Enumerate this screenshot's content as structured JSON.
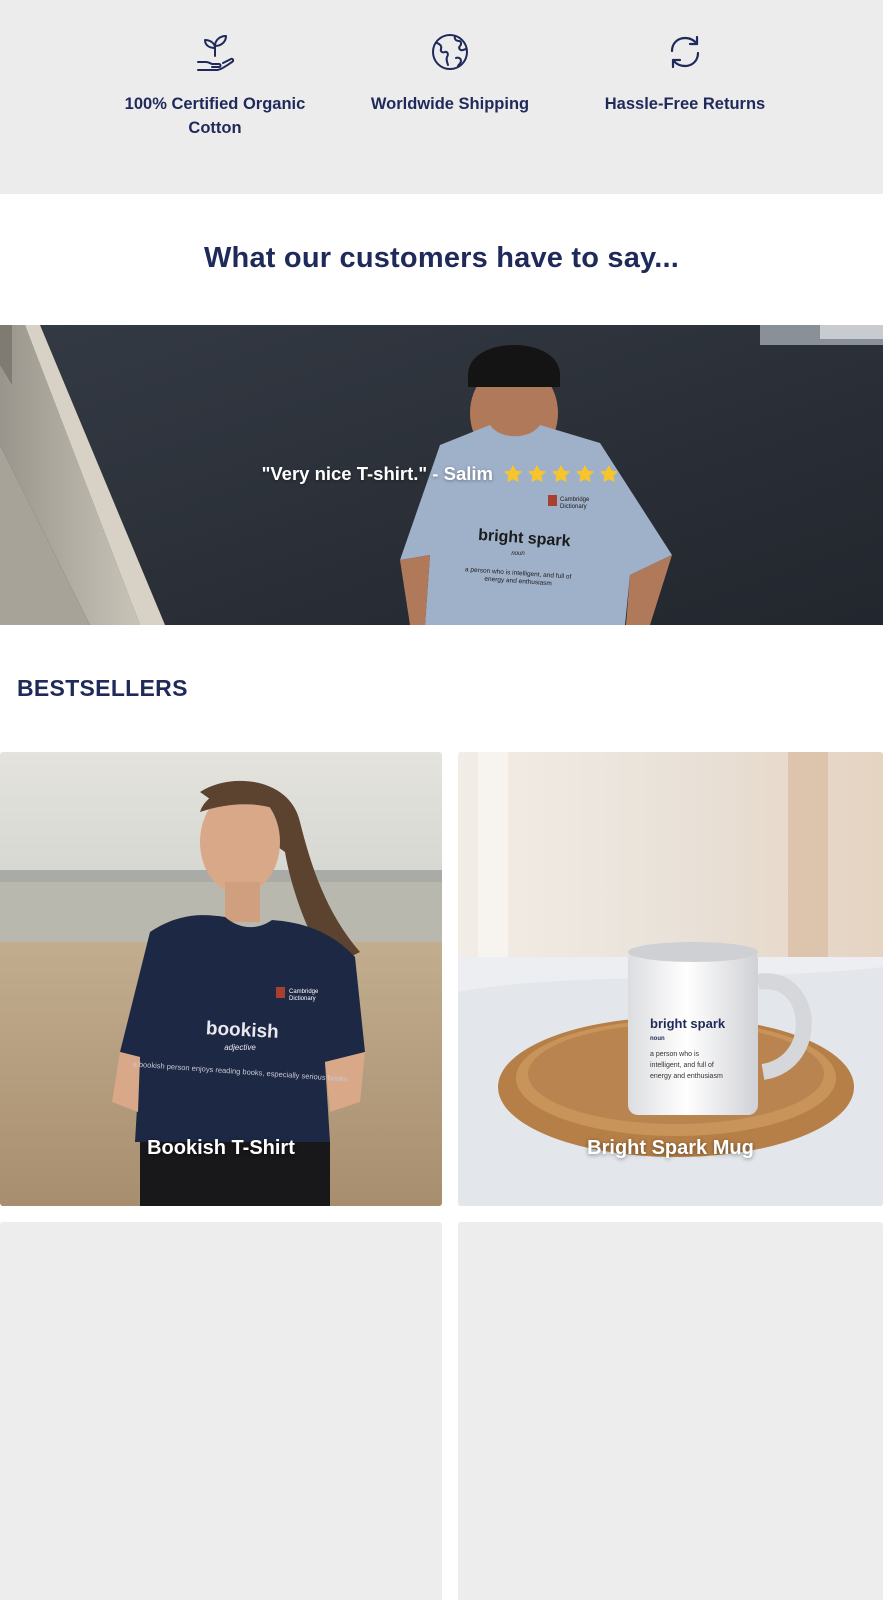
{
  "features": [
    {
      "icon": "plant-in-hand-icon",
      "label": "100% Certified Organic Cotton"
    },
    {
      "icon": "globe-icon",
      "label": "Worldwide Shipping"
    },
    {
      "icon": "refresh-icon",
      "label": "Hassle-Free Returns"
    }
  ],
  "testimonials": {
    "heading": "What our customers have to say...",
    "quote": "\"Very nice T-shirt.\" - Salim",
    "rating": 5,
    "shirt_print": {
      "title": "bright spark",
      "pos": "noun",
      "definition": "a person who is intelligent, and full of energy and enthusiasm",
      "logo_text": "Cambridge Dictionary"
    }
  },
  "bestsellers": {
    "title": "BESTSELLERS",
    "products": [
      {
        "name": "Bookish T-Shirt",
        "print_title": "bookish",
        "print_pos": "adjective",
        "print_def": "a bookish person enjoys reading books, especially serious books"
      },
      {
        "name": "Bright Spark Mug",
        "print_title": "bright spark",
        "print_pos": "noun",
        "print_def": "a person who is intelligent, and full of energy and enthusiasm"
      },
      {
        "name": ""
      },
      {
        "name": ""
      }
    ]
  },
  "colors": {
    "navy": "#1f2a5a",
    "star": "#f7c52b",
    "strip_bg": "#ececec"
  }
}
